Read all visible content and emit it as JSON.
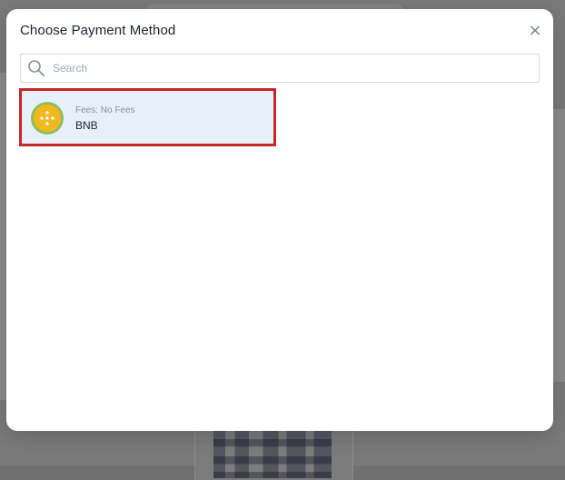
{
  "modal": {
    "title": "Choose Payment Method",
    "close_symbol": "×"
  },
  "search": {
    "placeholder": "Search",
    "value": ""
  },
  "methods": [
    {
      "fees": "Fees: No Fees",
      "name": "BNB",
      "icon": "bnb-coin-icon",
      "selected": true
    }
  ],
  "colors": {
    "modal_bg": "#ffffff",
    "overlay": "#7a7a7a",
    "item_bg": "#e6f0fa",
    "highlight_border": "#c62828",
    "bnb_yellow": "#f2b81f",
    "bnb_ring": "#8fbf5a"
  }
}
